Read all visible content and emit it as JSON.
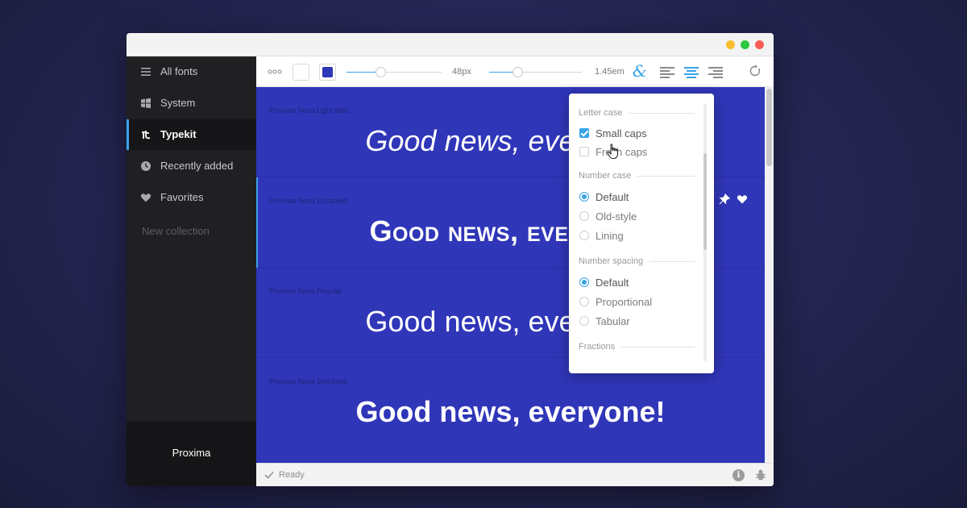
{
  "colors": {
    "accent": "#3aa3e8",
    "background_color": "#3036b8",
    "text_color_swatch": "#ffffff",
    "selected_swatch": "#3036b8"
  },
  "sidebar": {
    "items": [
      {
        "label": "All fonts",
        "icon": "menu-icon"
      },
      {
        "label": "System",
        "icon": "windows-icon"
      },
      {
        "label": "Typekit",
        "icon": "typekit-icon",
        "active": true
      },
      {
        "label": "Recently added",
        "icon": "clock-icon"
      },
      {
        "label": "Favorites",
        "icon": "heart-icon"
      }
    ],
    "new_collection": "New collection",
    "footer": "Proxima"
  },
  "toolbar": {
    "more_icon": "more-dots-icon",
    "font_size": "48px",
    "font_size_level": 0.36,
    "line_height": "1.45em",
    "line_height_level": 0.3,
    "opentype_icon": "ampersand-icon",
    "align_options": [
      "left",
      "center",
      "right"
    ],
    "align_selected": "center"
  },
  "fonts": [
    {
      "name": "Proxima Nova Light Italic",
      "sample": "Good news, everyone!"
    },
    {
      "name": "Proxima Nova Extrabold",
      "sample": "Good news, everyone!",
      "selected": true
    },
    {
      "name": "Proxima Nova Regular",
      "sample": "Good news, everyone!"
    },
    {
      "name": "Proxima Nova Semibold",
      "sample": "Good news, everyone!"
    }
  ],
  "status": {
    "text": "Ready",
    "info_icon": "i"
  },
  "opentype_panel": {
    "letter_case": {
      "title": "Letter case",
      "options": [
        {
          "label": "Small caps",
          "checked": true
        },
        {
          "label": "Fresh caps",
          "checked": false
        }
      ]
    },
    "number_case": {
      "title": "Number case",
      "options": [
        {
          "label": "Default",
          "selected": true
        },
        {
          "label": "Old-style",
          "selected": false
        },
        {
          "label": "Lining",
          "selected": false
        }
      ]
    },
    "number_spacing": {
      "title": "Number spacing",
      "options": [
        {
          "label": "Default",
          "selected": true
        },
        {
          "label": "Proportional",
          "selected": false
        },
        {
          "label": "Tabular",
          "selected": false
        }
      ]
    },
    "fractions": {
      "title": "Fractions"
    }
  }
}
